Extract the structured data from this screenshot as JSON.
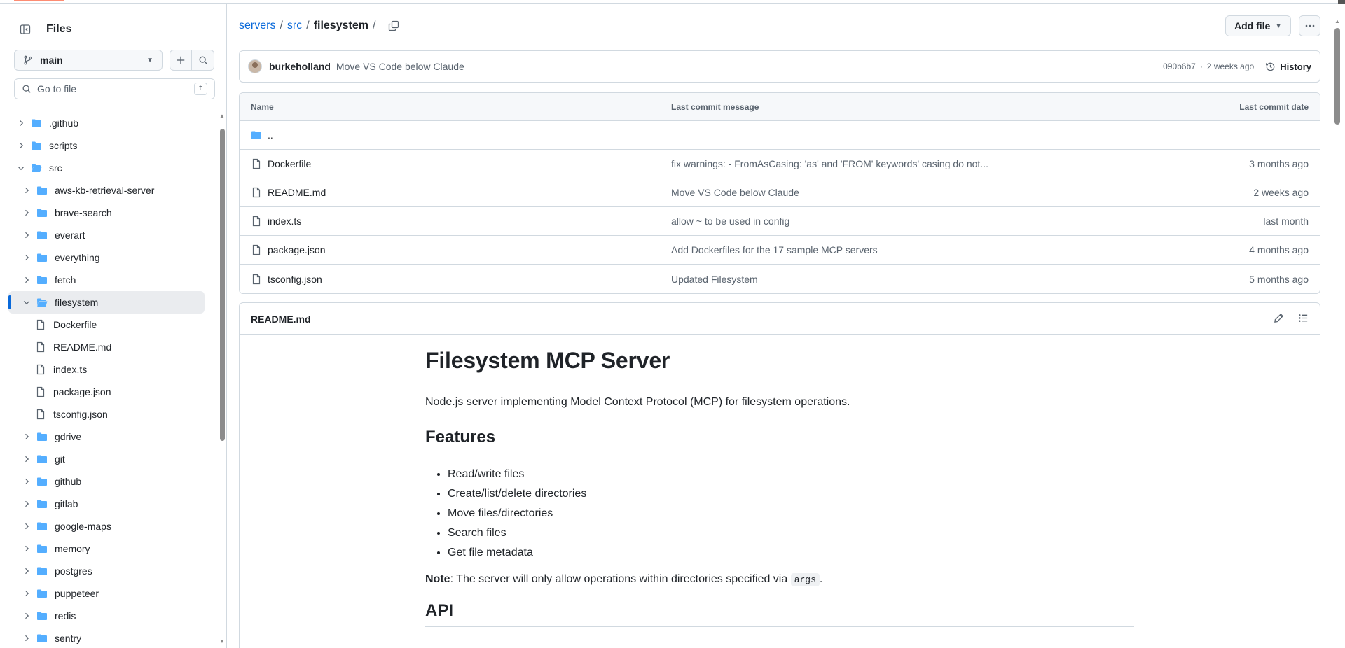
{
  "sidebar": {
    "title": "Files",
    "branch": "main",
    "search_placeholder": "Go to file",
    "search_shortcut": "t",
    "tree": [
      {
        "label": ".github",
        "type": "folder",
        "depth": 0,
        "expanded": false
      },
      {
        "label": "scripts",
        "type": "folder",
        "depth": 0,
        "expanded": false
      },
      {
        "label": "src",
        "type": "folder",
        "depth": 0,
        "expanded": true
      },
      {
        "label": "aws-kb-retrieval-server",
        "type": "folder",
        "depth": 1,
        "expanded": false
      },
      {
        "label": "brave-search",
        "type": "folder",
        "depth": 1,
        "expanded": false
      },
      {
        "label": "everart",
        "type": "folder",
        "depth": 1,
        "expanded": false
      },
      {
        "label": "everything",
        "type": "folder",
        "depth": 1,
        "expanded": false
      },
      {
        "label": "fetch",
        "type": "folder",
        "depth": 1,
        "expanded": false
      },
      {
        "label": "filesystem",
        "type": "folder",
        "depth": 1,
        "expanded": true,
        "active": true
      },
      {
        "label": "Dockerfile",
        "type": "file",
        "depth": 2
      },
      {
        "label": "README.md",
        "type": "file",
        "depth": 2
      },
      {
        "label": "index.ts",
        "type": "file",
        "depth": 2
      },
      {
        "label": "package.json",
        "type": "file",
        "depth": 2
      },
      {
        "label": "tsconfig.json",
        "type": "file",
        "depth": 2
      },
      {
        "label": "gdrive",
        "type": "folder",
        "depth": 1,
        "expanded": false
      },
      {
        "label": "git",
        "type": "folder",
        "depth": 1,
        "expanded": false
      },
      {
        "label": "github",
        "type": "folder",
        "depth": 1,
        "expanded": false
      },
      {
        "label": "gitlab",
        "type": "folder",
        "depth": 1,
        "expanded": false
      },
      {
        "label": "google-maps",
        "type": "folder",
        "depth": 1,
        "expanded": false
      },
      {
        "label": "memory",
        "type": "folder",
        "depth": 1,
        "expanded": false
      },
      {
        "label": "postgres",
        "type": "folder",
        "depth": 1,
        "expanded": false
      },
      {
        "label": "puppeteer",
        "type": "folder",
        "depth": 1,
        "expanded": false
      },
      {
        "label": "redis",
        "type": "folder",
        "depth": 1,
        "expanded": false
      },
      {
        "label": "sentry",
        "type": "folder",
        "depth": 1,
        "expanded": false
      }
    ]
  },
  "breadcrumb": {
    "repo": "servers",
    "sep1": "/",
    "dir": "src",
    "sep2": "/",
    "current": "filesystem",
    "sep3": "/"
  },
  "actions": {
    "add_file": "Add file"
  },
  "latest_commit": {
    "author": "burkeholland",
    "message": "Move VS Code below Claude",
    "sha": "090b6b7",
    "separator": "·",
    "time": "2 weeks ago",
    "history_label": "History"
  },
  "file_table": {
    "headers": {
      "name": "Name",
      "message": "Last commit message",
      "date": "Last commit date"
    },
    "parent": "..",
    "rows": [
      {
        "name": "Dockerfile",
        "message": "fix warnings: - FromAsCasing: 'as' and 'FROM' keywords' casing do not...",
        "date": "3 months ago"
      },
      {
        "name": "README.md",
        "message": "Move VS Code below Claude",
        "date": "2 weeks ago"
      },
      {
        "name": "index.ts",
        "message": "allow ~ to be used in config",
        "date": "last month"
      },
      {
        "name": "package.json",
        "message": "Add Dockerfiles for the 17 sample MCP servers",
        "date": "4 months ago"
      },
      {
        "name": "tsconfig.json",
        "message": "Updated Filesystem",
        "date": "5 months ago"
      }
    ]
  },
  "readme": {
    "filename": "README.md",
    "title": "Filesystem MCP Server",
    "intro": "Node.js server implementing Model Context Protocol (MCP) for filesystem operations.",
    "features_heading": "Features",
    "features": [
      "Read/write files",
      "Create/list/delete directories",
      "Move files/directories",
      "Search files",
      "Get file metadata"
    ],
    "note_label": "Note",
    "note_text": ": The server will only allow operations within directories specified via ",
    "note_code": "args",
    "note_end": ".",
    "api_heading": "API"
  },
  "colors": {
    "accent": "#0969da",
    "folder": "#54aeff",
    "border": "#d1d9e0",
    "muted": "#59636e"
  }
}
